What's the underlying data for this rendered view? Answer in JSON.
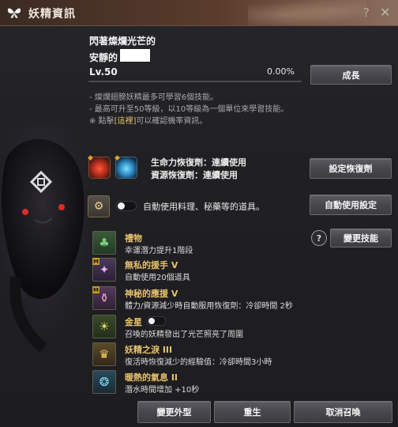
{
  "window": {
    "title": "妖精資訊",
    "help_glyph": "?",
    "close_glyph": "✕",
    "title_icon": "butterfly-icon"
  },
  "fairy": {
    "name_line1": "閃著燦爛光芒的",
    "name_line2": "安靜的",
    "level": "Lv.50",
    "exp_percent": "0.00%",
    "exp_fraction": 0.0
  },
  "buttons": {
    "grow": "成長",
    "set_recovery": "設定恢復劑",
    "auto_use_settings": "自動使用設定",
    "change_skill": "變更技能",
    "change_look": "變更外型",
    "rebirth": "重生",
    "cancel_summon": "取消召喚"
  },
  "info": {
    "line1": "- 燦爛翅膀妖精最多可學習6個技能。",
    "line2": "- 最高可升至50等級，以10等級為一個單位來學習技能。",
    "line3_prefix": "※ 點擊",
    "line3_link": "[這裡]",
    "line3_suffix": "可以確認機率資訊。"
  },
  "recovery": {
    "hp_label": "生命力恢復劑：連續使用",
    "mp_label": "資源恢復劑：連續使用"
  },
  "auto_use": {
    "label": "自動使用料理、秘藥等的道具。",
    "enabled": false
  },
  "skills": [
    {
      "name": "禮物",
      "desc": "幸運潛力提升1階段",
      "badge": "",
      "icon": "clover-icon"
    },
    {
      "name": "無私的援手 V",
      "desc": "自動使用20個道具",
      "badge": "M",
      "icon": "fairy-wand-icon"
    },
    {
      "name": "神秘的應援 V",
      "desc": "體力/資源減少時自動服用恢復劑：冷卻時間 2秒",
      "badge": "M",
      "icon": "potion-icon"
    },
    {
      "name": "金星",
      "desc": "召喚的妖精發出了光芒照亮了周圍",
      "badge": "",
      "icon": "lantern-icon",
      "toggle": false
    },
    {
      "name": "妖精之淚 III",
      "desc": "復活時恢復減少的經驗值：冷卻時間3小時",
      "badge": "",
      "icon": "tear-trophy-icon"
    },
    {
      "name": "暖熱的氣息 II",
      "desc": "潛水時間增加 +10秒",
      "badge": "",
      "icon": "breath-icon"
    }
  ],
  "colors": {
    "accent_gold": "#e9c36b",
    "title_bar": "#5a3c2c",
    "panel": "#222225"
  }
}
